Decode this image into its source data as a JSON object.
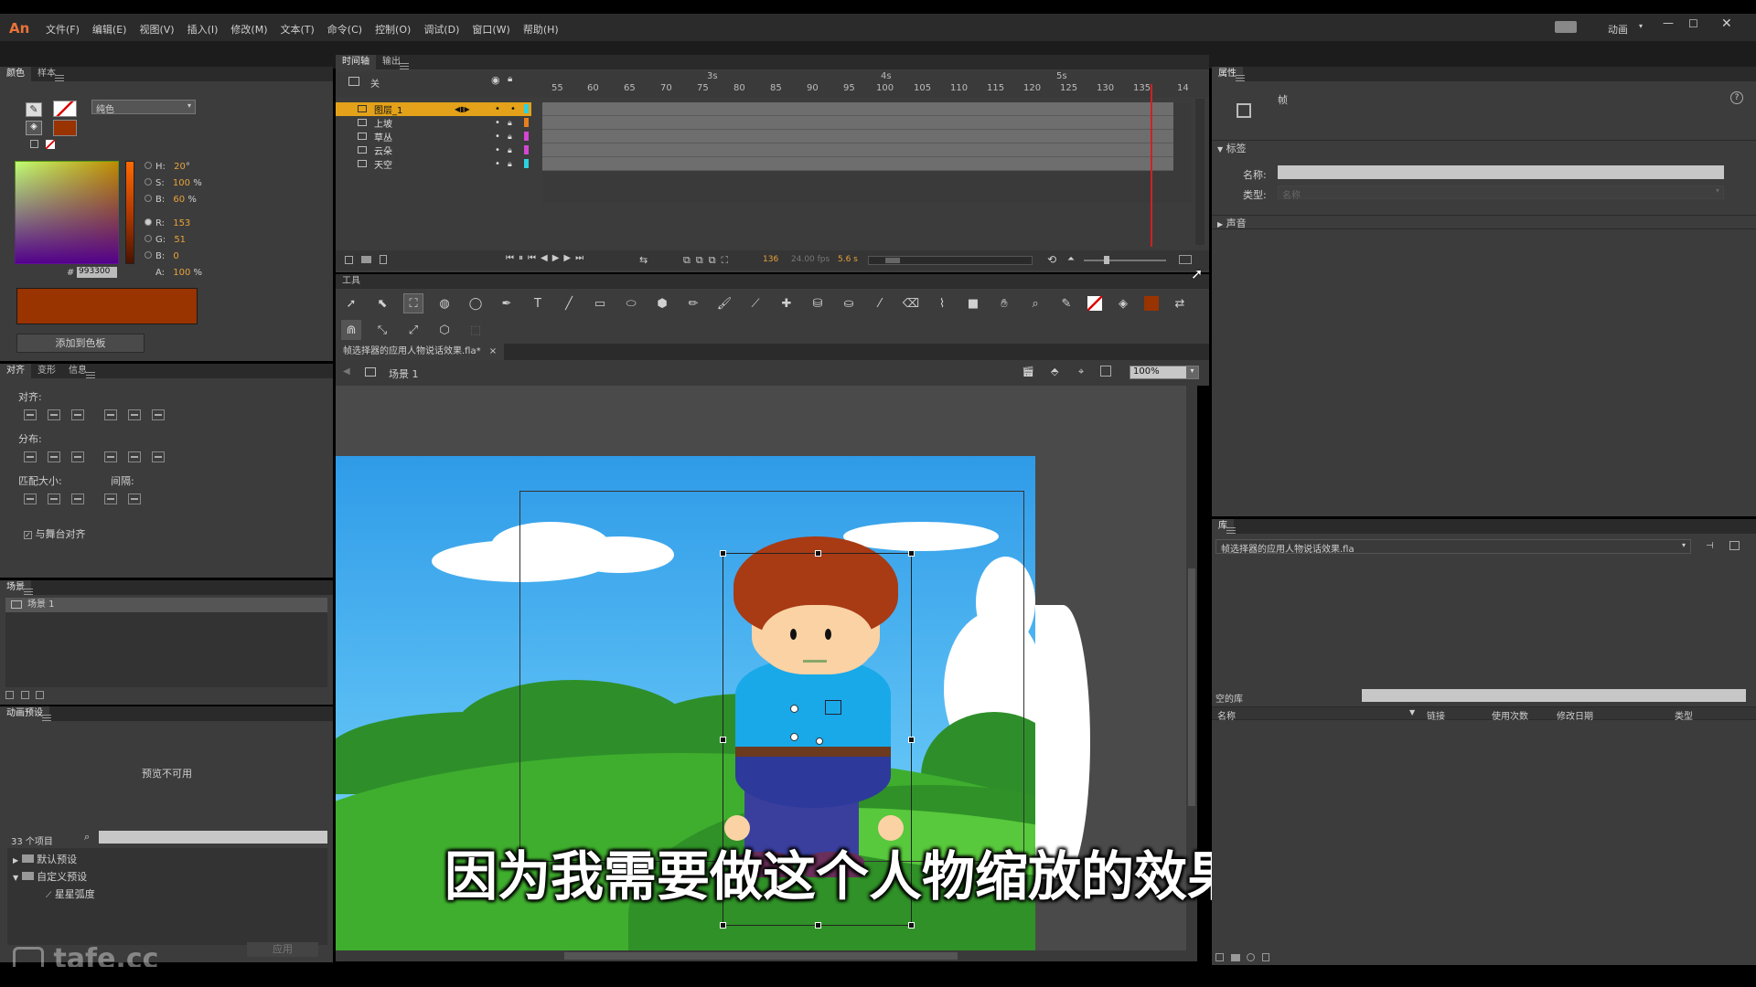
{
  "app": {
    "logo": "An",
    "menus": [
      "文件(F)",
      "编辑(E)",
      "视图(V)",
      "插入(I)",
      "修改(M)",
      "文本(T)",
      "命令(C)",
      "控制(O)",
      "调试(D)",
      "窗口(W)",
      "帮助(H)"
    ],
    "workspace": "动画",
    "accent": "#e8733a"
  },
  "color_panel": {
    "tabs": [
      "颜色",
      "样本"
    ],
    "fill_type": "纯色",
    "H": "20",
    "S": "100",
    "B": "60",
    "R": "153",
    "G": "51",
    "Bv": "0",
    "A": "100",
    "hex": "993300",
    "degree": "°",
    "pct": "%",
    "labels": {
      "H": "H:",
      "S": "S:",
      "B": "B:",
      "R": "R:",
      "G": "G:",
      "Bb": "B:",
      "A": "A:",
      "hash": "#"
    },
    "swatch_color": "#993300",
    "add_button": "添加到色板"
  },
  "align_panel": {
    "tabs": [
      "对齐",
      "变形",
      "信息"
    ],
    "align_label": "对齐:",
    "distribute_label": "分布:",
    "match_size_label": "匹配大小:",
    "spacing_label": "间隔:",
    "stage_align": "与舞台对齐"
  },
  "scene_panel": {
    "tab": "场景",
    "scene": "场景 1"
  },
  "motion_presets": {
    "tab": "动画预设",
    "preview": "预览不可用",
    "count": "33 个项目",
    "items": [
      "默认预设",
      "自定义预设",
      "星星弧度"
    ],
    "apply": "应用"
  },
  "timeline": {
    "tabs": [
      "时间轴",
      "输出"
    ],
    "header_label": "关",
    "seconds": [
      "3s",
      "4s",
      "5s"
    ],
    "frame_numbers": [
      "55",
      "60",
      "65",
      "70",
      "75",
      "80",
      "85",
      "90",
      "95",
      "100",
      "105",
      "110",
      "115",
      "120",
      "125",
      "130",
      "135",
      "14"
    ],
    "layers": [
      {
        "name": "图层_1",
        "color": "#2ed1e0",
        "selected": true
      },
      {
        "name": "上坡",
        "color": "#e87f1f",
        "selected": false
      },
      {
        "name": "草丛",
        "color": "#d347d3",
        "selected": false
      },
      {
        "name": "云朵",
        "color": "#d347d3",
        "selected": false
      },
      {
        "name": "天空",
        "color": "#2ed1e0",
        "selected": false
      }
    ],
    "current_frame": "136",
    "fps": "24.00 fps",
    "elapsed": "5.6 s"
  },
  "tools": {
    "header": "工具"
  },
  "document": {
    "tab": "帧选择器的应用人物说话效果.fla*",
    "scene": "场景 1",
    "zoom": "100%"
  },
  "subtitle": "因为我需要做这个人物缩放的效果",
  "watermark": "tafe.cc",
  "properties": {
    "tab": "属性",
    "type": "帧",
    "label_section": "标签",
    "name_label": "名称:",
    "type_label": "类型:",
    "type_value": "名称",
    "sound_section": "声音"
  },
  "library": {
    "tab": "库",
    "file": "帧选择器的应用人物说话效果.fla",
    "empty": "空的库",
    "columns": [
      "名称",
      "链接",
      "使用次数",
      "修改日期",
      "类型"
    ]
  },
  "colors": {
    "sky_top": "#2f9be8",
    "sky_bottom": "#5ec1f5",
    "grass": "#3fae2e",
    "hair": "#a83a14",
    "shirt": "#19a9e8",
    "pants": "#2d3a9b",
    "skin": "#fbd2a4"
  }
}
